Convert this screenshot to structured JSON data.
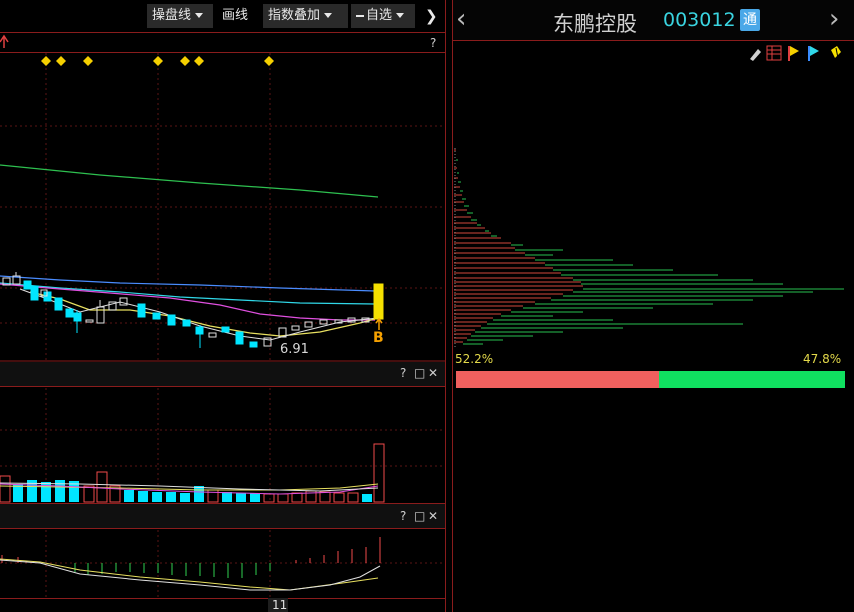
{
  "toolbar": {
    "operate_line": "操盘线",
    "draw_line": "画线",
    "index_overlay": "指数叠加",
    "watchlist": "自选",
    "collapse": "❯"
  },
  "panel": {
    "stock_name": "东鹏控股",
    "stock_code": "003012",
    "connect_badge": "通",
    "prev": "‹",
    "next": "›"
  },
  "main_chart": {
    "help": "?",
    "low_price_label": "6.91",
    "buy_signal": "B"
  },
  "volume_panel": {
    "help": "?",
    "restore": "□",
    "close": "✕"
  },
  "indicator_panel": {
    "help": "?",
    "restore": "□",
    "close": "✕"
  },
  "x_axis": {
    "month_label": "11"
  },
  "chip_distribution": {
    "profit_pct": "52.2%",
    "loss_pct": "47.8%",
    "profit_ratio": 0.522,
    "loss_ratio": 0.478,
    "colors": {
      "profit": "#f0605e",
      "loss": "#10e060"
    }
  },
  "icons": [
    "eraser-icon",
    "grid-icon",
    "flag-red-icon",
    "flag-blue-icon",
    "paint-bucket-icon"
  ]
}
